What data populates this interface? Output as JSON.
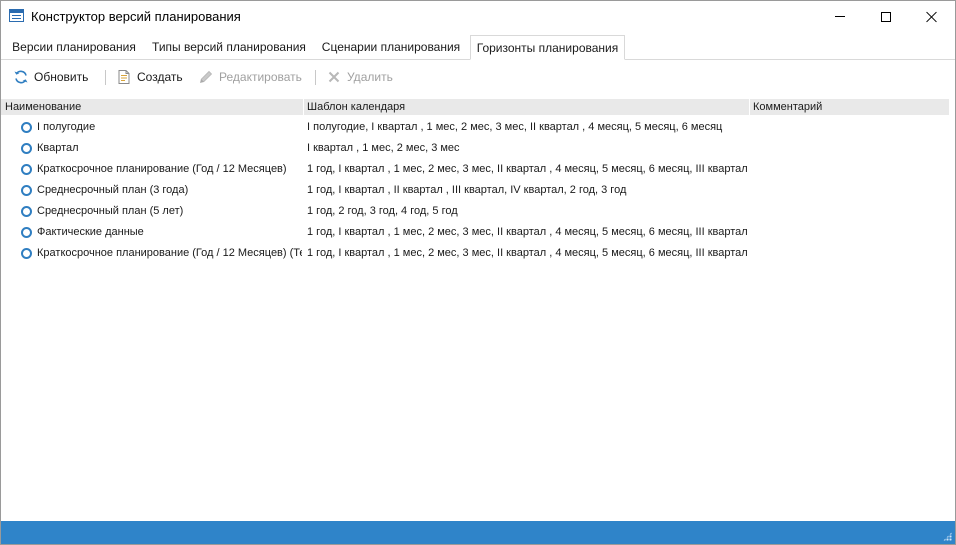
{
  "window": {
    "title": "Конструктор версий планирования"
  },
  "tabs": [
    {
      "label": "Версии планирования",
      "active": false
    },
    {
      "label": "Типы версий планирования",
      "active": false
    },
    {
      "label": "Сценарии планирования",
      "active": false
    },
    {
      "label": "Горизонты планирования",
      "active": true
    }
  ],
  "toolbar": {
    "refresh": {
      "label": "Обновить",
      "icon": "refresh-icon",
      "enabled": true
    },
    "create": {
      "label": "Создать",
      "icon": "new-document-icon",
      "enabled": true
    },
    "edit": {
      "label": "Редактировать",
      "icon": "pencil-icon",
      "enabled": false
    },
    "delete": {
      "label": "Удалить",
      "icon": "x-icon",
      "enabled": false
    }
  },
  "grid": {
    "columns": [
      "Наименование",
      "Шаблон календаря",
      "Комментарий"
    ],
    "rows": [
      {
        "name": "I полугодие",
        "template": "I полугодие, I квартал , 1 мес, 2 мес, 3 мес, II квартал , 4 месяц, 5 месяц, 6 месяц",
        "comment": ""
      },
      {
        "name": "Квартал",
        "template": "I квартал , 1 мес, 2 мес, 3 мес",
        "comment": ""
      },
      {
        "name": "Краткосрочное планирование (Год / 12 Месяцев)",
        "template": "1 год, I квартал , 1 мес, 2 мес, 3 мес, II квартал , 4 месяц, 5 месяц, 6 месяц, III квартал",
        "comment": ""
      },
      {
        "name": "Среднесрочный план (3 года)",
        "template": "1 год, I квартал , II квартал , III квартал, IV квартал, 2 год, 3 год",
        "comment": ""
      },
      {
        "name": "Среднесрочный план (5 лет)",
        "template": "1 год, 2 год, 3 год, 4 год, 5 год",
        "comment": ""
      },
      {
        "name": "Фактические данные",
        "template": "1 год, I квартал , 1 мес, 2 мес, 3 мес, II квартал , 4 месяц, 5 месяц, 6 месяц, III квартал",
        "comment": ""
      },
      {
        "name": "Краткосрочное планирование (Год / 12 Месяцев) (Те",
        "template": "1 год, I квартал , 1 мес, 2 мес, 3 мес, II квартал , 4 месяц, 5 месяц, 6 месяц, III квартал",
        "comment": ""
      }
    ]
  },
  "colors": {
    "accent": "#2f7ec1",
    "statusbar": "#2f84c9",
    "header_bg": "#e9e9e9",
    "disabled_text": "#a0a0a0"
  }
}
